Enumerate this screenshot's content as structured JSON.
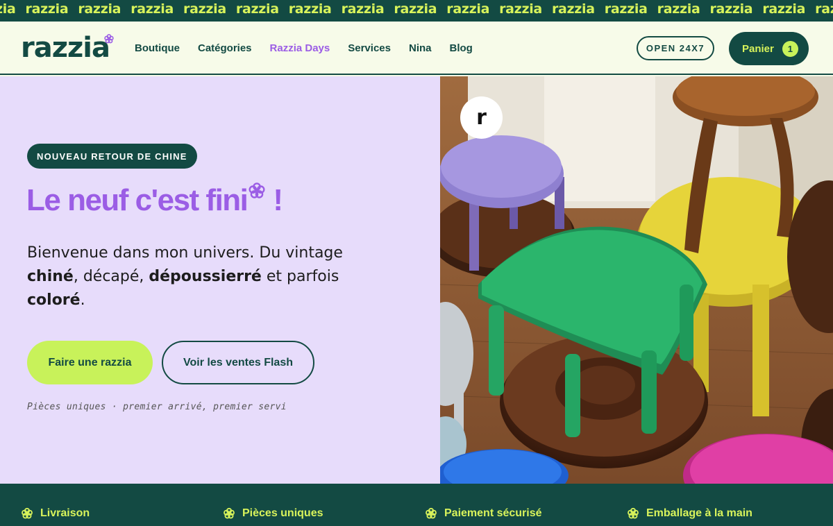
{
  "marquee": {
    "words": [
      "zia",
      "razzia",
      "razzia",
      "razzia",
      "razzia",
      "razzia",
      "razzia",
      "razzia",
      "razzia",
      "razzia",
      "razzia",
      "razzia",
      "razzia",
      "razzia",
      "razzia",
      "razzia",
      "razzia"
    ]
  },
  "header": {
    "logo": "razzia",
    "nav": [
      {
        "label": "Boutique",
        "active": false
      },
      {
        "label": "Catégories",
        "active": false
      },
      {
        "label": "Razzia Days",
        "active": true
      },
      {
        "label": "Services",
        "active": false
      },
      {
        "label": "Nina",
        "active": false
      },
      {
        "label": "Blog",
        "active": false
      }
    ],
    "open_badge": "OPEN 24X7",
    "cart_label": "Panier",
    "cart_count": "1"
  },
  "hero": {
    "tag": "NOUVEAU RETOUR DE CHINE",
    "headline": "Le neuf c'est fini",
    "headline_end": "!",
    "intro": {
      "p1": "Bienvenue dans mon univers. Du vintage ",
      "b1": "chiné",
      "p2": ", décapé, ",
      "b2": "dépoussierré",
      "p3": " et parfois ",
      "b3": "coloré",
      "p4": "."
    },
    "primary_button": "Faire une razzia",
    "secondary_button": "Voir les ventes Flash",
    "note": "Pièces uniques · premier arrivé, premier servi",
    "badge_letter": "r"
  },
  "features": [
    {
      "label": "Livraison",
      "icon": "flower-icon"
    },
    {
      "label": "Pièces uniques",
      "icon": "flower-icon"
    },
    {
      "label": "Paiement sécurisé",
      "icon": "flower-icon"
    },
    {
      "label": "Emballage à la main",
      "icon": "flower-icon"
    }
  ],
  "colors": {
    "brand_dark": "#134a43",
    "lime": "#c8f25a",
    "purple": "#9b5de5",
    "lavender_bg": "#e7dcfb"
  }
}
